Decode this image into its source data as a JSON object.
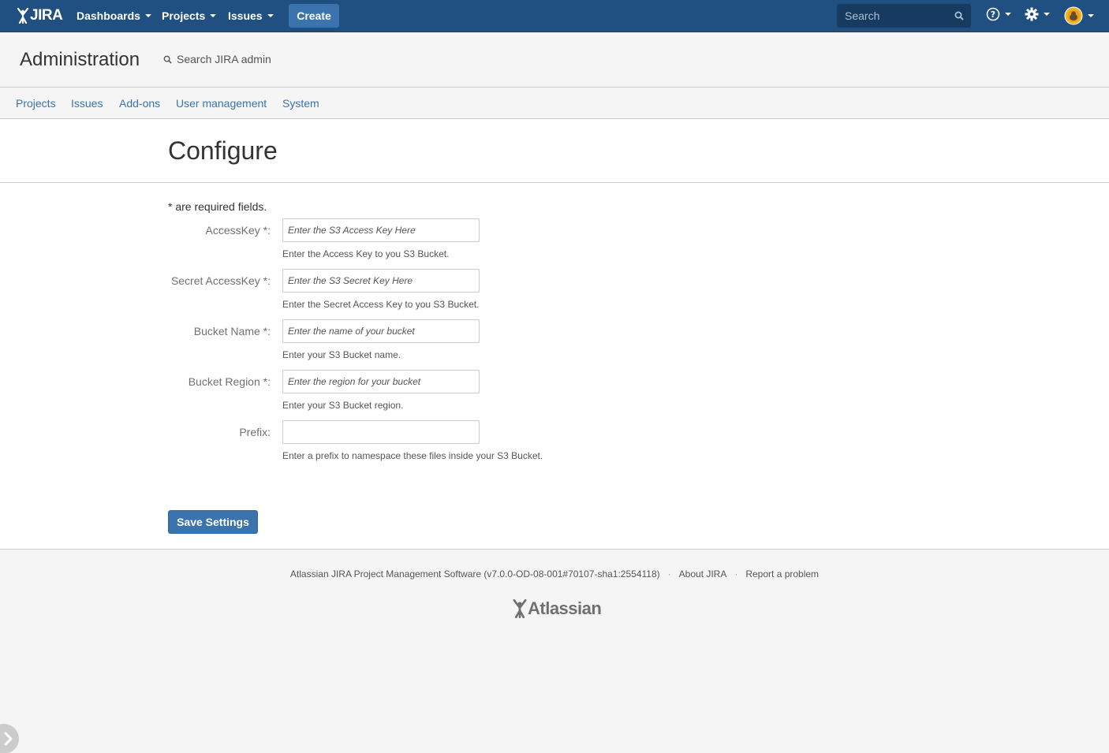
{
  "header": {
    "logo_text": "JIRA",
    "nav": [
      {
        "label": "Dashboards"
      },
      {
        "label": "Projects"
      },
      {
        "label": "Issues"
      }
    ],
    "create_label": "Create",
    "search_placeholder": "Search",
    "icons": [
      "help-icon",
      "gear-icon",
      "avatar"
    ]
  },
  "admin": {
    "title": "Administration",
    "search_label": "Search JIRA admin",
    "tabs": [
      {
        "label": "Projects"
      },
      {
        "label": "Issues"
      },
      {
        "label": "Add-ons"
      },
      {
        "label": "User management"
      },
      {
        "label": "System"
      }
    ]
  },
  "page": {
    "title": "Configure",
    "required_note": "* are required fields.",
    "fields": [
      {
        "label": "AccessKey *:",
        "placeholder": "Enter the S3 Access Key Here",
        "value": "",
        "description": "Enter the Access Key to you S3 Bucket."
      },
      {
        "label": "Secret AccessKey *:",
        "placeholder": "Enter the S3 Secret Key Here",
        "value": "",
        "description": "Enter the Secret Access Key to you S3 Bucket."
      },
      {
        "label": "Bucket Name *:",
        "placeholder": "Enter the name of your bucket",
        "value": "",
        "description": "Enter your S3 Bucket name."
      },
      {
        "label": "Bucket Region *:",
        "placeholder": "Enter the region for your bucket",
        "value": "",
        "description": "Enter your S3 Bucket region."
      },
      {
        "label": "Prefix:",
        "placeholder": "",
        "value": "",
        "description": "Enter a prefix to namespace these files inside your S3 Bucket."
      }
    ],
    "save_label": "Save Settings"
  },
  "footer": {
    "version_text": "Atlassian JIRA Project Management Software (v7.0.0-OD-08-001#70107-sha1:2554118)",
    "about_label": "About JIRA",
    "report_label": "Report a problem",
    "separator": "·",
    "brand": "Atlassian"
  },
  "colors": {
    "header_bg": "#205081",
    "accent": "#3b73af",
    "link": "#3b73af"
  }
}
